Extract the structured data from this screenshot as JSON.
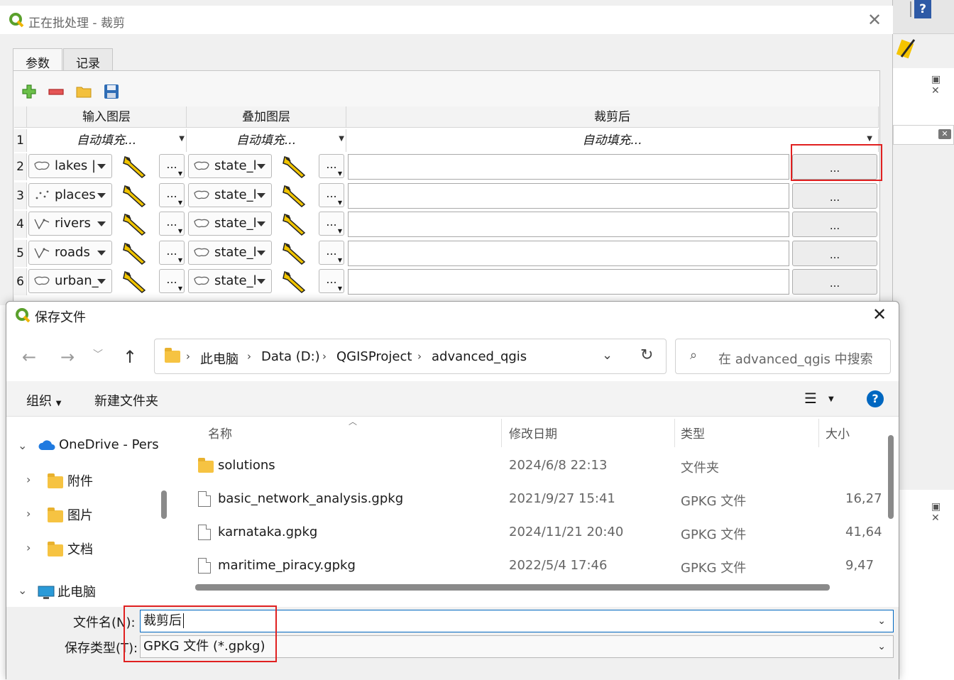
{
  "batch": {
    "title": "正在批处理 - 裁剪",
    "tabs": [
      "参数",
      "记录"
    ],
    "columns": [
      "输入图层",
      "叠加图层",
      "裁剪后"
    ],
    "autofill": "自动填充...",
    "rows": [
      {
        "num": "1"
      },
      {
        "num": "2",
        "input": "lakes |",
        "overlay": "state_l",
        "browse": "..."
      },
      {
        "num": "3",
        "input": "places",
        "overlay": "state_l",
        "browse": "..."
      },
      {
        "num": "4",
        "input": "rivers",
        "overlay": "state_l",
        "browse": "..."
      },
      {
        "num": "5",
        "input": "roads",
        "overlay": "state_l",
        "browse": "..."
      },
      {
        "num": "6",
        "input": "urban_",
        "overlay": "state_l",
        "browse": "..."
      }
    ],
    "dots": "..."
  },
  "save": {
    "title": "保存文件",
    "breadcrumb": [
      "此电脑",
      "Data (D:)",
      "QGISProject",
      "advanced_qgis"
    ],
    "search_placeholder": "在 advanced_qgis 中搜索",
    "toolbar": {
      "organize": "组织",
      "new_folder": "新建文件夹"
    },
    "tree": [
      {
        "label": "OneDrive - Pers"
      },
      {
        "label": "附件"
      },
      {
        "label": "图片"
      },
      {
        "label": "文档"
      },
      {
        "label": "此电脑"
      }
    ],
    "columns": {
      "name": "名称",
      "date": "修改日期",
      "type": "类型",
      "size": "大小"
    },
    "files": [
      {
        "name": "solutions",
        "date": "2024/6/8 22:13",
        "type": "文件夹",
        "size": ""
      },
      {
        "name": "basic_network_analysis.gpkg",
        "date": "2021/9/27 15:41",
        "type": "GPKG 文件",
        "size": "16,27"
      },
      {
        "name": "karnataka.gpkg",
        "date": "2024/11/21 20:40",
        "type": "GPKG 文件",
        "size": "41,64"
      },
      {
        "name": "maritime_piracy.gpkg",
        "date": "2022/5/4 17:46",
        "type": "GPKG 文件",
        "size": "9,47"
      }
    ],
    "filename_label": "文件名(N):",
    "filename_value": "裁剪后",
    "filetype_label": "保存类型(T):",
    "filetype_value": "GPKG 文件 (*.gpkg)"
  },
  "bg": {
    "help_glyph": "?"
  },
  "colors": {
    "accent": "#0067c0",
    "highlight": "#e02020",
    "qgis_green": "#5aa02c"
  }
}
